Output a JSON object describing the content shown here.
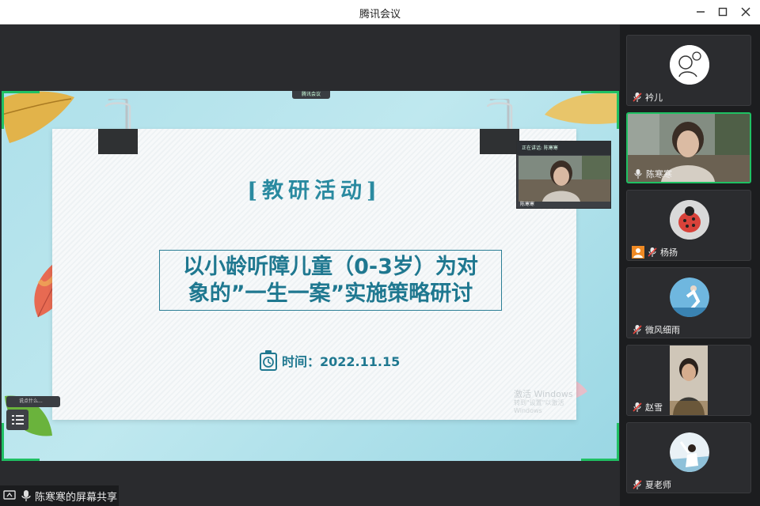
{
  "window": {
    "title": "腾讯会议"
  },
  "slide": {
    "tag": "[教研活动]",
    "title_line_1": "以小龄听障儿童（0-3岁）为对",
    "title_line_2": "象的”一生一案”实施策略研讨",
    "date": "时间：2022.11.15",
    "watermark_1": "激活 Windows",
    "watermark_2": "转到\"设置\"以激活 Windows"
  },
  "share_badge": "腾讯会议",
  "presenter_preview": {
    "header": "正在讲话: 陈寒寒",
    "name": "陈寒寒"
  },
  "chat_pill": "说点什么...",
  "status": {
    "label": "陈寒寒的屏幕共享"
  },
  "participants": [
    {
      "name": "衿儿",
      "muted": true
    },
    {
      "name": "陈寒寒",
      "muted": false,
      "active": true
    },
    {
      "name": "杨扬",
      "muted": true
    },
    {
      "name": "微风细雨",
      "muted": true
    },
    {
      "name": "赵雪",
      "muted": true
    },
    {
      "name": "夏老师",
      "muted": true
    }
  ],
  "colors": {
    "accent": "#1fc063",
    "title_text": "#1f7890",
    "mute_red": "#e8453c",
    "panel_bg": "#1c1d1f"
  },
  "icons": [
    "minimize-icon",
    "maximize-icon",
    "close-icon",
    "microphone-icon",
    "microphone-muted-icon",
    "list-icon",
    "share-screen-icon",
    "clock-icon",
    "person-icon"
  ]
}
